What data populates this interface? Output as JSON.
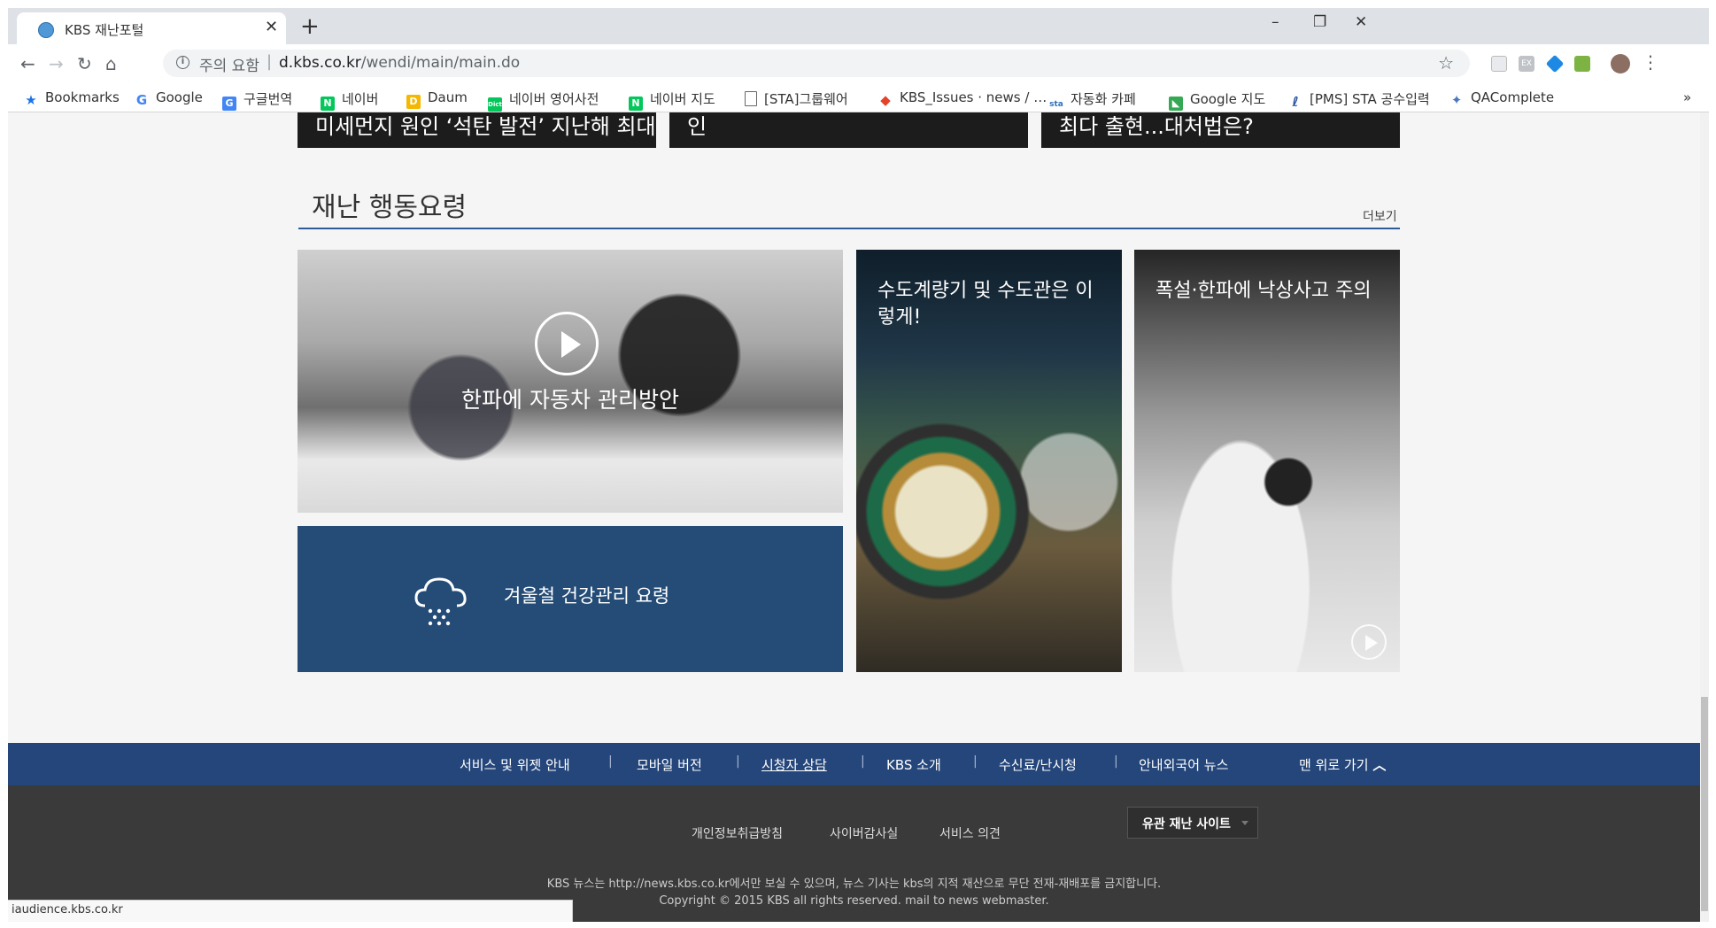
{
  "browser": {
    "tab_title": "KBS 재난포털",
    "tab_close": "✕",
    "new_tab": "+",
    "window_controls": {
      "minimize": "–",
      "restore": "❐",
      "close": "✕"
    },
    "nav": {
      "back": "←",
      "forward": "→",
      "reload": "↻",
      "home": "⌂"
    },
    "security_label": "주의 요함",
    "url_host": "d.kbs.co.kr",
    "url_path": "/wendi/main/main.do",
    "bookmark_star": "☆",
    "menu_dots": "⋮"
  },
  "bookmarks": [
    {
      "label": "Bookmarks",
      "icon": "star-icon",
      "color": "#1a73e8",
      "glyph": "★"
    },
    {
      "label": "Google",
      "icon": "google-icon",
      "color": "#4285f4",
      "glyph": "G"
    },
    {
      "label": "구글번역",
      "icon": "translate-icon",
      "color": "#4285f4",
      "glyph": "G"
    },
    {
      "label": "네이버",
      "icon": "naver-icon",
      "color": "#03c75a",
      "glyph": "N"
    },
    {
      "label": "Daum",
      "icon": "daum-icon",
      "color": "#f5b700",
      "glyph": "D"
    },
    {
      "label": "네이버 영어사전",
      "icon": "naver-dict-icon",
      "color": "#03c75a",
      "glyph": "D"
    },
    {
      "label": "네이버 지도",
      "icon": "naver-map-icon",
      "color": "#03c75a",
      "glyph": "N"
    },
    {
      "label": "[STA]그룹웨어",
      "icon": "page-icon",
      "color": "#ffffff",
      "glyph": ""
    },
    {
      "label": "KBS_Issues · news / …",
      "icon": "gitlab-icon",
      "color": "#e24329",
      "glyph": "◆"
    },
    {
      "label": "자동화 카페",
      "icon": "cafe-icon",
      "color": "#2d6fbf",
      "glyph": "s"
    },
    {
      "label": "Google 지도",
      "icon": "maps-icon",
      "color": "#34a853",
      "glyph": "◣"
    },
    {
      "label": "[PMS] STA 공수입력",
      "icon": "pms-icon",
      "color": "#1f4e9b",
      "glyph": "ℓ"
    },
    {
      "label": "QAComplete",
      "icon": "qacomplete-icon",
      "color": "#4a78b8",
      "glyph": "✦"
    }
  ],
  "bookmarks_overflow": "»",
  "top_captions": [
    "미세먼지 원인 ‘석탄 발전’ 지난해 최대",
    "인",
    "최다 출현...대처법은?"
  ],
  "section": {
    "title": "재난 행동요령",
    "more": "더보기"
  },
  "cards": {
    "car": "한파에 자동차 관리방안",
    "health": "겨울철 건강관리 요령",
    "meter": "수도계량기 및 수도관은 이렇게!",
    "slip": "폭설·한파에 낙상사고 주의"
  },
  "footer_nav": [
    "서비스 및 위젯 안내",
    "모바일 버전",
    "시청자 상담",
    "KBS 소개",
    "수신료/난시청",
    "안내외국어 뉴스"
  ],
  "footer_nav_separator": "|",
  "back_to_top": "맨 위로 가기",
  "footer_links": [
    "개인정보취급방침",
    "사이버감사실",
    "서비스 의견"
  ],
  "related_sites": "유관 재난 사이트",
  "notice": "KBS 뉴스는 http://news.kbs.co.kr에서만 보실 수 있으며, 뉴스 기사는 kbs의 지적 재산으로 무단 전재-재배포를 금지합니다.",
  "copyright": "Copyright © 2015 KBS all rights reserved. mail to news webmaster.",
  "status_url": "iaudience.kbs.co.kr",
  "colors": {
    "section_rule": "#2d5b9a",
    "footer_nav_bg": "#25467a",
    "footer_bg": "#3a3a3a",
    "health_box": "#244c77"
  }
}
